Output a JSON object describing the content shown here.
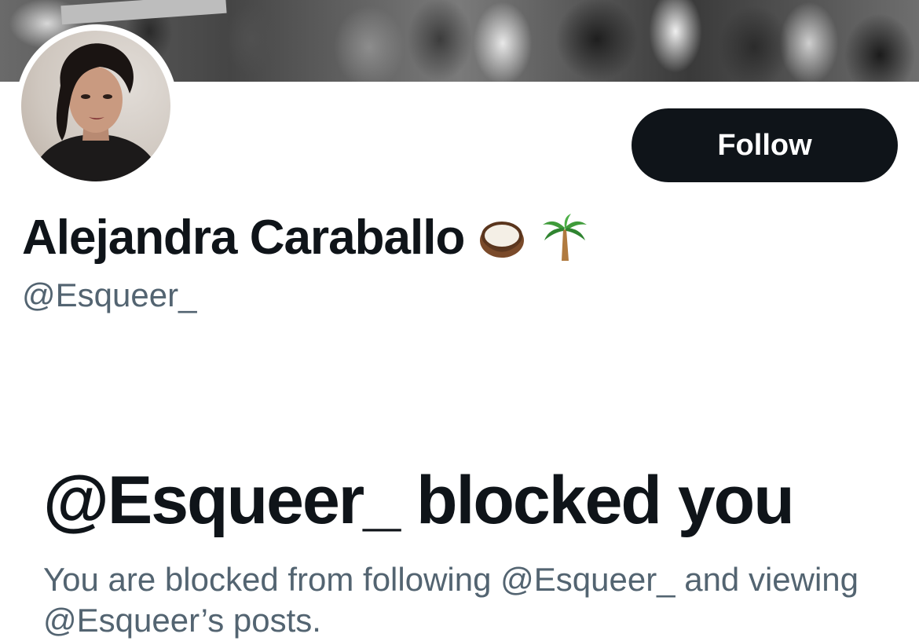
{
  "profile": {
    "display_name": "Alejandra Caraballo",
    "name_emojis": [
      "coconut-icon",
      "palm-tree-icon"
    ],
    "handle": "@Esqueer_",
    "follow_label": "Follow"
  },
  "blocked": {
    "title": "@Esqueer_ blocked you",
    "description": "You are blocked from following @Esqueer_ and viewing @Esqueer’s posts."
  },
  "colors": {
    "text_primary": "#0f1419",
    "text_secondary": "#536471",
    "button_bg": "#0f1419",
    "button_text": "#ffffff",
    "background": "#ffffff"
  }
}
